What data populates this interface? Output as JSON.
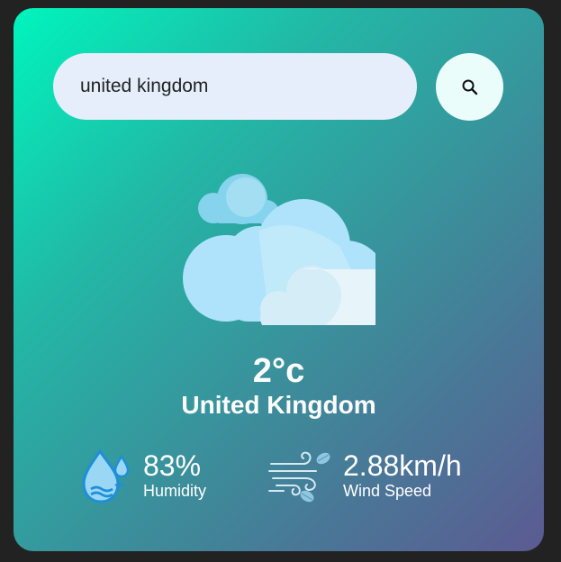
{
  "search": {
    "value": "united kingdom"
  },
  "weather": {
    "icon": "clouds-icon",
    "temperature": "2°c",
    "city": "United Kingdom"
  },
  "details": {
    "humidity": {
      "icon": "humidity-icon",
      "value": "83%",
      "label": "Humidity"
    },
    "wind": {
      "icon": "wind-icon",
      "value": "2.88km/h",
      "label": "Wind Speed"
    }
  },
  "colors": {
    "gradient_start": "#00f5bd",
    "gradient_end": "#5c5a92",
    "input_bg": "#e6eefb",
    "button_bg": "#eafdfb"
  }
}
